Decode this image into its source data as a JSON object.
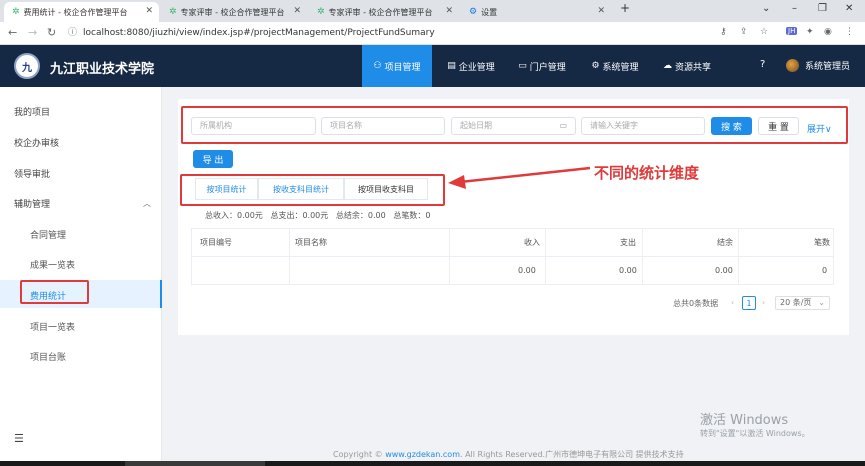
{
  "browser": {
    "tabs": [
      {
        "title": "费用统计 - 校企合作管理平台",
        "active": true
      },
      {
        "title": "专家评审 - 校企合作管理平台",
        "active": false
      },
      {
        "title": "专家评审 - 校企合作管理平台",
        "active": false
      },
      {
        "title": "设置",
        "active": false
      }
    ],
    "url": "localhost:8080/jiuzhi/view/index.jsp#/projectManagement/ProjectFundSumary"
  },
  "header": {
    "site_name": "九江职业技术学院",
    "nav": [
      "项目管理",
      "企业管理",
      "门户管理",
      "系统管理",
      "资源共享"
    ],
    "user": "系统管理员"
  },
  "sidebar": {
    "items": [
      "我的项目",
      "校企办审核",
      "领导审批",
      "辅助管理"
    ],
    "sub_items": [
      "合同管理",
      "成果一览表",
      "费用统计",
      "项目一览表",
      "项目台账"
    ]
  },
  "filters": {
    "org_placeholder": "所属机构",
    "name_placeholder": "项目名称",
    "start_placeholder": "起始日期",
    "keyword_placeholder": "请输入关键字",
    "search_label": "搜 索",
    "reset_label": "重 置",
    "expand_label": "展开"
  },
  "export_label": "导 出",
  "subtabs": [
    "按项目统计",
    "按收支科目统计",
    "按项目收支科目"
  ],
  "annotation": "不同的统计维度",
  "summary": "总收入：0.00元   总支出：0.00元   总结余：0.00   总笔数：0",
  "table": {
    "headers": [
      "项目编号",
      "项目名称",
      "收入",
      "支出",
      "结余",
      "笔数"
    ],
    "row": [
      "",
      "",
      "0.00",
      "0.00",
      "0.00",
      "0"
    ]
  },
  "pagination": {
    "total_text": "总共0条数据",
    "current_page": "1",
    "page_size": "20 条/页"
  },
  "watermark": {
    "line1": "激活 Windows",
    "line2": "转到\"设置\"以激活 Windows。"
  },
  "footer": {
    "prefix": "Copyright © ",
    "link": "www.gzdekan.com",
    "suffix": ". All Rights Reserved.广州市德坤电子有限公司 提供技术支持"
  },
  "colors": {
    "header_bg": "#162944",
    "accent": "#1f8ce8",
    "annotation_red": "#e03a3a"
  }
}
